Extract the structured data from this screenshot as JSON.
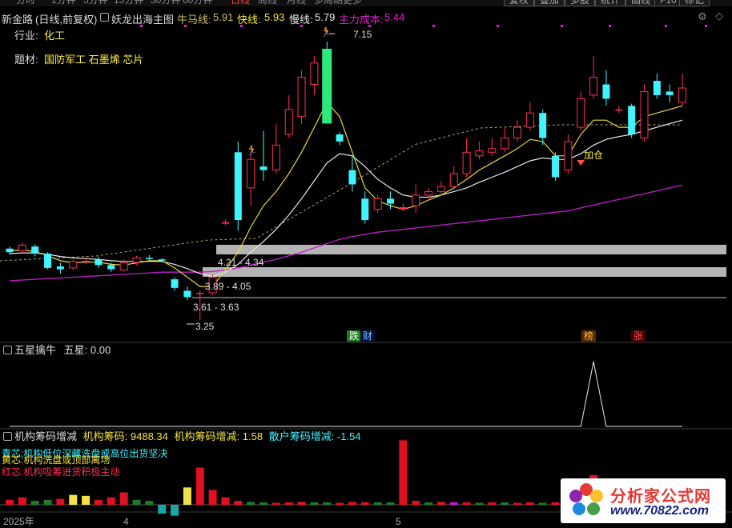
{
  "topbar": {
    "tabs": [
      "分时",
      "1分钟",
      "5分钟",
      "15分钟",
      "30分钟",
      "60分钟",
      "日线",
      "周线",
      "月线",
      "多周期",
      "更多"
    ],
    "buttons": [
      "复权",
      "叠加",
      "多股",
      "统计",
      "画线",
      "F10",
      "标记"
    ]
  },
  "main_header": {
    "stock": "新金路",
    "period": "(日线,前复权)",
    "indicator": "妖龙出海主图",
    "niuma_label": "牛马线:",
    "niuma_value": "5.91",
    "fast_label": "快线:",
    "fast_value": "5.93",
    "slow_label": "慢线:",
    "slow_value": "5.79",
    "cost_label": "主力成本:",
    "cost_value": "5.44"
  },
  "info": {
    "industry_label": "行业:",
    "industry_value": "化工",
    "theme_label": "题材:",
    "theme_value": "国防军工 石墨烯 芯片"
  },
  "annotations": {
    "peak": "7.15",
    "low": "3.25",
    "zone1": "4.21 - 4.34",
    "zone2": "3.89 - 4.05",
    "zone3": "3.61 - 3.63",
    "jiacang": "加仓"
  },
  "badges": {
    "die": "跌",
    "cai": "财",
    "bang": "榜",
    "zhang": "张"
  },
  "sub1": {
    "title": "五星擒牛",
    "value_label": "五星:",
    "value": "0.00"
  },
  "sub2": {
    "title": "机构筹码增减",
    "chip_label": "机构筹码:",
    "chip_value": "9488.34",
    "delta_label": "机构筹码增减:",
    "delta_value": "1.58",
    "retail_label": "散户筹码增减:",
    "retail_value": "-1.54",
    "legend": [
      "青芯:机构低位深藏洗盘或高位出货坚决",
      "黄芯:机构洗盘或顶部离场",
      "红芯:机构吸筹进货积极主动"
    ]
  },
  "xaxis": {
    "year": "2025年",
    "m1": "4",
    "m2": "5"
  },
  "watermark": {
    "title": "分析家公式网",
    "url": "www.70822.com"
  },
  "colors": {
    "up": "#ff2d55",
    "down": "#3ff3ff",
    "yellow": "#f2e24a",
    "magenta": "#e0e",
    "accent": "#e81bd3"
  },
  "candles": [
    {
      "o": 4.25,
      "c": 4.2,
      "h": 4.28,
      "l": 4.17
    },
    {
      "o": 4.22,
      "c": 4.3,
      "h": 4.33,
      "l": 4.19
    },
    {
      "o": 4.28,
      "c": 4.18,
      "h": 4.31,
      "l": 4.14
    },
    {
      "o": 4.18,
      "c": 3.98,
      "h": 4.2,
      "l": 3.96
    },
    {
      "o": 4.0,
      "c": 3.96,
      "h": 4.05,
      "l": 3.9
    },
    {
      "o": 3.98,
      "c": 4.07,
      "h": 4.1,
      "l": 3.95
    },
    {
      "o": 4.07,
      "c": 4.08,
      "h": 4.14,
      "l": 4.03
    },
    {
      "o": 4.1,
      "c": 4.02,
      "h": 4.14,
      "l": 3.98
    },
    {
      "o": 4.02,
      "c": 3.96,
      "h": 4.05,
      "l": 3.92
    },
    {
      "o": 3.95,
      "c": 4.05,
      "h": 4.1,
      "l": 3.93
    },
    {
      "o": 4.06,
      "c": 4.12,
      "h": 4.15,
      "l": 4.02
    },
    {
      "o": 4.12,
      "c": 4.11,
      "h": 4.16,
      "l": 4.07
    },
    {
      "o": 4.1,
      "c": 4.09,
      "h": 4.12,
      "l": 4.06
    },
    {
      "o": 3.82,
      "c": 3.7,
      "h": 3.85,
      "l": 3.66
    },
    {
      "o": 3.66,
      "c": 3.57,
      "h": 3.72,
      "l": 3.53
    },
    {
      "o": 3.62,
      "c": 3.63,
      "h": 3.66,
      "l": 3.25
    },
    {
      "o": 3.63,
      "c": 3.85,
      "h": 3.89,
      "l": 3.6
    },
    {
      "o": 4.6,
      "c": 4.62,
      "h": 4.66,
      "l": 4.58
    },
    {
      "o": 5.6,
      "c": 4.65,
      "h": 5.75,
      "l": 4.5
    },
    {
      "o": 5.1,
      "c": 5.5,
      "h": 5.6,
      "l": 4.85
    },
    {
      "o": 5.4,
      "c": 5.35,
      "h": 5.9,
      "l": 5.2
    },
    {
      "o": 5.35,
      "c": 5.7,
      "h": 6.0,
      "l": 5.3
    },
    {
      "o": 5.85,
      "c": 6.2,
      "h": 6.4,
      "l": 5.8
    },
    {
      "o": 6.1,
      "c": 6.65,
      "h": 6.75,
      "l": 6.0
    },
    {
      "o": 6.55,
      "c": 6.85,
      "h": 6.95,
      "l": 6.4
    },
    {
      "o": 6.95,
      "c": 6.45,
      "h": 7.15,
      "l": 6.4
    },
    {
      "o": 5.85,
      "c": 5.75,
      "h": 5.88,
      "l": 5.7
    },
    {
      "o": 5.35,
      "c": 5.15,
      "h": 5.55,
      "l": 5.05
    },
    {
      "o": 4.95,
      "c": 4.65,
      "h": 5.05,
      "l": 4.6
    },
    {
      "o": 4.8,
      "c": 4.95,
      "h": 5.0,
      "l": 4.75
    },
    {
      "o": 4.95,
      "c": 4.88,
      "h": 5.05,
      "l": 4.8
    },
    {
      "o": 4.8,
      "c": 4.83,
      "h": 4.88,
      "l": 4.78
    },
    {
      "o": 4.85,
      "c": 5.0,
      "h": 5.15,
      "l": 4.75
    },
    {
      "o": 5.0,
      "c": 5.05,
      "h": 5.1,
      "l": 4.95
    },
    {
      "o": 5.05,
      "c": 5.12,
      "h": 5.2,
      "l": 5.0
    },
    {
      "o": 5.12,
      "c": 5.3,
      "h": 5.4,
      "l": 5.1
    },
    {
      "o": 5.3,
      "c": 5.6,
      "h": 5.8,
      "l": 5.25
    },
    {
      "o": 5.55,
      "c": 5.62,
      "h": 5.75,
      "l": 5.5
    },
    {
      "o": 5.6,
      "c": 5.65,
      "h": 5.8,
      "l": 5.55
    },
    {
      "o": 5.65,
      "c": 5.8,
      "h": 5.95,
      "l": 5.6
    },
    {
      "o": 5.8,
      "c": 5.95,
      "h": 6.05,
      "l": 5.75
    },
    {
      "o": 5.95,
      "c": 6.15,
      "h": 6.3,
      "l": 5.9
    },
    {
      "o": 6.15,
      "c": 5.8,
      "h": 6.2,
      "l": 5.7
    },
    {
      "o": 5.55,
      "c": 5.25,
      "h": 5.6,
      "l": 5.2
    },
    {
      "o": 5.35,
      "c": 5.75,
      "h": 5.85,
      "l": 5.3
    },
    {
      "o": 5.95,
      "c": 6.35,
      "h": 6.45,
      "l": 5.9
    },
    {
      "o": 6.4,
      "c": 6.65,
      "h": 6.95,
      "l": 6.35
    },
    {
      "o": 6.55,
      "c": 6.35,
      "h": 6.75,
      "l": 6.25
    },
    {
      "o": 6.2,
      "c": 6.2,
      "h": 6.25,
      "l": 6.15
    },
    {
      "o": 6.25,
      "c": 5.85,
      "h": 6.28,
      "l": 5.8
    },
    {
      "o": 5.8,
      "c": 6.45,
      "h": 6.55,
      "l": 5.75
    },
    {
      "o": 6.6,
      "c": 6.4,
      "h": 6.7,
      "l": 6.35
    },
    {
      "o": 6.45,
      "c": 6.4,
      "h": 6.55,
      "l": 6.3
    },
    {
      "o": 6.3,
      "c": 6.5,
      "h": 6.7,
      "l": 6.25
    }
  ],
  "fast_line": [
    4.22,
    4.23,
    4.21,
    4.15,
    4.08,
    4.05,
    4.06,
    4.06,
    4.03,
    4.02,
    4.05,
    4.08,
    4.08,
    3.98,
    3.85,
    3.72,
    3.72,
    3.95,
    4.2,
    4.55,
    4.85,
    5.05,
    5.3,
    5.6,
    5.95,
    6.3,
    6.1,
    5.6,
    5.1,
    4.92,
    4.85,
    4.8,
    4.85,
    4.93,
    5.0,
    5.1,
    5.22,
    5.35,
    5.45,
    5.55,
    5.65,
    5.78,
    5.75,
    5.55,
    5.55,
    5.85,
    6.05,
    6.05,
    5.95,
    5.95,
    6.1,
    6.15,
    6.2,
    6.25
  ],
  "slow_line": [
    4.18,
    4.19,
    4.19,
    4.17,
    4.14,
    4.12,
    4.11,
    4.1,
    4.08,
    4.07,
    4.07,
    4.07,
    4.07,
    4.03,
    3.97,
    3.9,
    3.86,
    3.92,
    4.03,
    4.2,
    4.35,
    4.52,
    4.72,
    4.95,
    5.2,
    5.45,
    5.58,
    5.55,
    5.4,
    5.22,
    5.1,
    5.0,
    4.97,
    4.97,
    5.0,
    5.05,
    5.1,
    5.18,
    5.25,
    5.32,
    5.4,
    5.48,
    5.52,
    5.5,
    5.5,
    5.58,
    5.7,
    5.78,
    5.82,
    5.85,
    5.9,
    5.95,
    6.0,
    6.05
  ],
  "cost_line": [
    3.8,
    3.81,
    3.82,
    3.83,
    3.84,
    3.85,
    3.86,
    3.87,
    3.88,
    3.89,
    3.9,
    3.91,
    3.92,
    3.92,
    3.92,
    3.92,
    3.93,
    3.95,
    3.98,
    4.02,
    4.06,
    4.1,
    4.15,
    4.2,
    4.26,
    4.32,
    4.38,
    4.42,
    4.45,
    4.48,
    4.5,
    4.52,
    4.54,
    4.56,
    4.58,
    4.6,
    4.62,
    4.64,
    4.66,
    4.68,
    4.7,
    4.72,
    4.74,
    4.76,
    4.78,
    4.82,
    4.86,
    4.9,
    4.94,
    4.98,
    5.02,
    5.06,
    5.1,
    5.14
  ],
  "five_star": [
    0,
    0,
    0,
    0,
    0,
    0,
    0,
    0,
    0,
    0,
    0,
    0,
    0,
    0,
    0,
    0,
    0,
    0,
    0,
    0,
    0,
    0,
    0,
    0,
    0,
    0,
    0,
    0,
    0,
    0,
    0,
    0,
    0,
    0,
    0,
    0,
    0,
    0,
    0,
    0,
    0,
    0,
    0,
    0,
    0,
    0,
    1,
    0,
    0,
    0,
    0,
    0,
    0,
    0
  ],
  "chip_bars": [
    {
      "v": 0.1,
      "t": "r"
    },
    {
      "v": 0.15,
      "t": "r"
    },
    {
      "v": 0.08,
      "t": "g"
    },
    {
      "v": 0.1,
      "t": "g"
    },
    {
      "v": 0.12,
      "t": "r"
    },
    {
      "v": 0.2,
      "t": "y"
    },
    {
      "v": 0.18,
      "t": "y"
    },
    {
      "v": 0.1,
      "t": "r"
    },
    {
      "v": 0.15,
      "t": "r"
    },
    {
      "v": 0.25,
      "t": "r"
    },
    {
      "v": 0.1,
      "t": "g"
    },
    {
      "v": 0.08,
      "t": "g"
    },
    {
      "v": -0.18,
      "t": "c"
    },
    {
      "v": -0.22,
      "t": "c"
    },
    {
      "v": 0.35,
      "t": "y"
    },
    {
      "v": 0.75,
      "t": "r"
    },
    {
      "v": 0.3,
      "t": "r"
    },
    {
      "v": 0.15,
      "t": "r"
    },
    {
      "v": 0.08,
      "t": "r"
    },
    {
      "v": 0.06,
      "t": "g"
    },
    {
      "v": 0.05,
      "t": "g"
    },
    {
      "v": 0.04,
      "t": "r"
    },
    {
      "v": 0.05,
      "t": "r"
    },
    {
      "v": 0.06,
      "t": "r"
    },
    {
      "v": 0.05,
      "t": "g"
    },
    {
      "v": 0.05,
      "t": "g"
    },
    {
      "v": 0.04,
      "t": "r"
    },
    {
      "v": 0.06,
      "t": "r"
    },
    {
      "v": 0.05,
      "t": "r"
    },
    {
      "v": 0.05,
      "t": "g"
    },
    {
      "v": 0.05,
      "t": "g"
    },
    {
      "v": 1.3,
      "t": "r"
    },
    {
      "v": 0.08,
      "t": "r"
    },
    {
      "v": 0.05,
      "t": "g"
    },
    {
      "v": 0.06,
      "t": "r"
    },
    {
      "v": 0.05,
      "t": "m"
    },
    {
      "v": 0.05,
      "t": "r"
    },
    {
      "v": 0.04,
      "t": "g"
    },
    {
      "v": 0.05,
      "t": "r"
    },
    {
      "v": 0.05,
      "t": "g"
    },
    {
      "v": 0.04,
      "t": "r"
    },
    {
      "v": 0.05,
      "t": "r"
    },
    {
      "v": 0.04,
      "t": "g"
    },
    {
      "v": 0.05,
      "t": "r"
    },
    {
      "v": 0.05,
      "t": "g"
    },
    {
      "v": 0.05,
      "t": "r"
    },
    {
      "v": 0.6,
      "t": "r"
    },
    {
      "v": 0.1,
      "t": "r"
    },
    {
      "v": 0.05,
      "t": "g"
    },
    {
      "v": 0.05,
      "t": "r"
    },
    {
      "v": 0.05,
      "t": "r"
    },
    {
      "v": 0.05,
      "t": "g"
    },
    {
      "v": 0.05,
      "t": "r"
    },
    {
      "v": 0.05,
      "t": "r"
    }
  ]
}
